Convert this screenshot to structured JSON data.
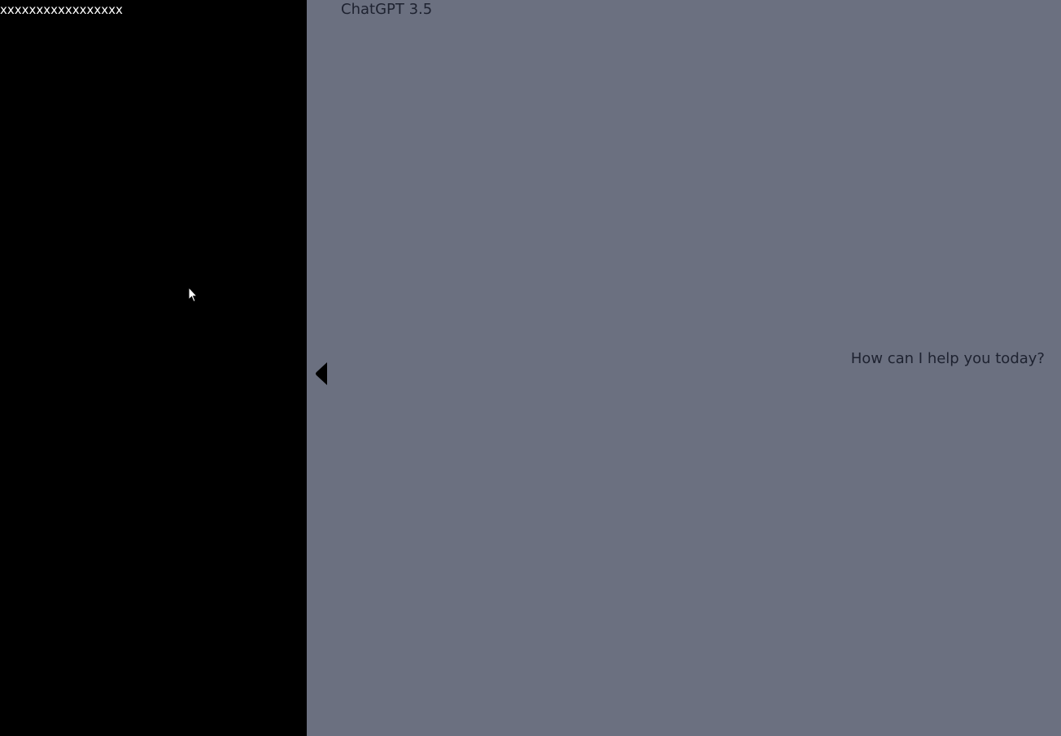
{
  "sidebar": {
    "title": "xxxxxxxxxxxxxxxxx"
  },
  "main": {
    "model_title": "ChatGPT 3.5",
    "greeting": "How can I help you today?"
  },
  "colors": {
    "sidebar_bg": "#000000",
    "main_bg": "#6b7080",
    "text_dark": "#1e2230",
    "text_light": "#ffffff"
  },
  "icons": {
    "collapse_toggle": "chevron-left-icon",
    "cursor": "mouse-pointer-icon"
  }
}
